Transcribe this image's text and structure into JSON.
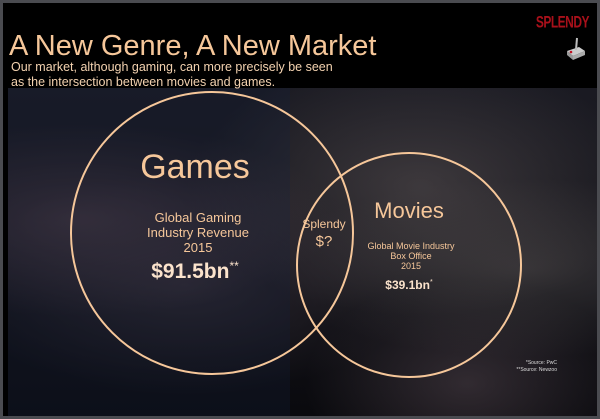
{
  "slide": {
    "logo": "SPLENDY",
    "logo_color": "#a8101a",
    "accent_color": "#f6c79a",
    "title": "A New Genre, A New Market",
    "subtitle": "Our market, although gaming, can more precisely be seen as the intersection between movies and games."
  },
  "venn": {
    "games": {
      "label": "Games",
      "desc_1": "Global Gaming",
      "desc_2": "Industry Revenue",
      "year": "2015",
      "value": "$91.5bn",
      "mark": "**"
    },
    "overlap": {
      "label": "Splendy",
      "value": "$?"
    },
    "movies": {
      "label": "Movies",
      "desc_1": "Global Movie Industry",
      "desc_2": "Box Office",
      "year": "2015",
      "value": "$39.1bn",
      "mark": "*"
    }
  },
  "sources": [
    "*Source: PwC",
    "**Source: Newzoo"
  ],
  "icons": {
    "logo_icon": "joystick-icon"
  }
}
